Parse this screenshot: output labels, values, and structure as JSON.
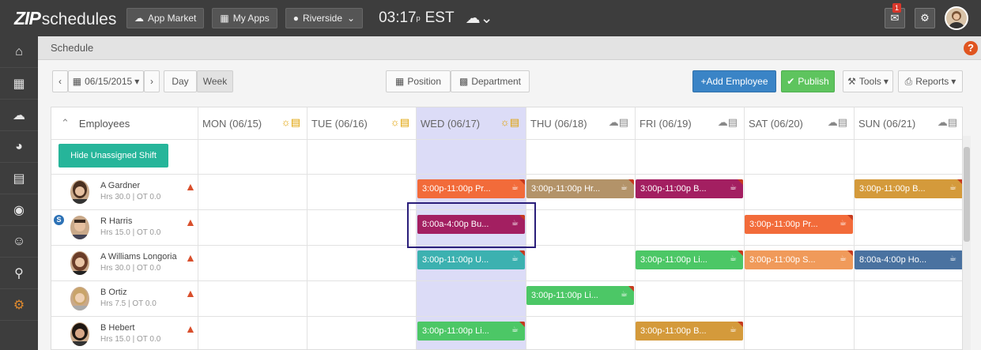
{
  "app": {
    "logo_zip": "ZIP",
    "logo_sched": "schedules"
  },
  "topbar": {
    "app_market": "App Market",
    "my_apps": "My Apps",
    "location": "Riverside",
    "time": "03:17",
    "period": "EST",
    "notif_count": "1"
  },
  "breadcrumb": "Schedule",
  "toolbar": {
    "date": "06/15/2015",
    "day": "Day",
    "week": "Week",
    "position": "Position",
    "department": "Department",
    "add_employee": "+Add Employee",
    "publish": "Publish",
    "tools": "Tools",
    "reports": "Reports"
  },
  "grid": {
    "employees_label": "Employees",
    "days": [
      "MON (06/15)",
      "TUE (06/16)",
      "WED (06/17)",
      "THU (06/18)",
      "FRI (06/19)",
      "SAT (06/20)",
      "SUN (06/21)"
    ],
    "hide_unassigned": "Hide Unassigned Shift",
    "employees": [
      {
        "name": "A Gardner",
        "hrs": "Hrs 30.0 | OT 0.0"
      },
      {
        "name": "R Harris",
        "hrs": "Hrs 15.0 | OT 0.0"
      },
      {
        "name": "A Williams Longoria",
        "hrs": "Hrs 30.0 | OT 0.0"
      },
      {
        "name": "B Ortiz",
        "hrs": "Hrs 7.5 | OT 0.0"
      },
      {
        "name": "B Hebert",
        "hrs": "Hrs 15.0 | OT 0.0"
      }
    ],
    "shifts": {
      "s0": "3:00p-11:00p Pr...",
      "s1": "3:00p-11:00p Hr...",
      "s2": "3:00p-11:00p B...",
      "s3": "3:00p-11:00p B...",
      "s4": "8:00a-4:00p Bu...",
      "s5": "3:00p-11:00p Pr...",
      "s6": "3:00p-11:00p U...",
      "s7": "3:00p-11:00p Li...",
      "s8": "3:00p-11:00p S...",
      "s9": "8:00a-4:00p Ho...",
      "s10": "3:00p-11:00p Li...",
      "s11": "3:00p-11:00p Li...",
      "s12": "3:00p-11:00p B..."
    }
  },
  "colors": {
    "orange": "#f26b3a",
    "khaki": "#b39369",
    "magenta": "#a31f61",
    "amber": "#d49a3b",
    "teal": "#3cb1b0",
    "green": "#4cc766",
    "salmon": "#f09a5a",
    "steel": "#4a72a0"
  }
}
